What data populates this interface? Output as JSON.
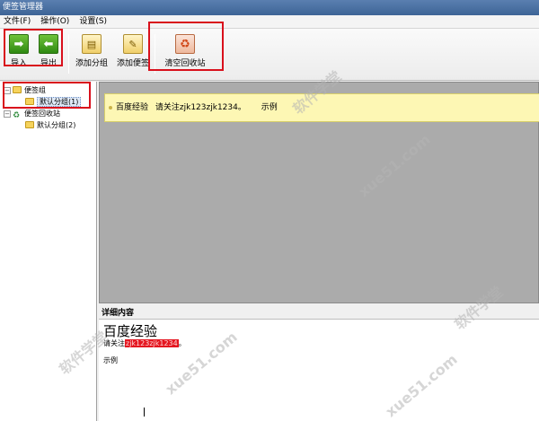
{
  "window": {
    "title": "便签管理器"
  },
  "menu": {
    "items": [
      "文件(F)",
      "操作(O)",
      "设置(S)"
    ]
  },
  "toolbar": {
    "import_label": "导入",
    "export_label": "导出",
    "add_group_label": "添加分组",
    "add_note_label": "添加便签",
    "empty_recycle_label": "清空回收站"
  },
  "tree": {
    "notes_group": "便签组",
    "notes_default": "默认分组(1)",
    "recycle": "便签回收站",
    "recycle_default": "默认分组(2)"
  },
  "notes": [
    {
      "title": "百度经验",
      "text": "请关注zjk123zjk1234。",
      "tag": "示例"
    }
  ],
  "detail": {
    "header": "详细内容",
    "title": "百度经验",
    "line_prefix": "请关注",
    "line_highlight": "zjk123zjk1234",
    "line_suffix": "。",
    "example": "示例"
  },
  "watermark": {
    "text": "软件学堂",
    "url": "xue51.com"
  }
}
